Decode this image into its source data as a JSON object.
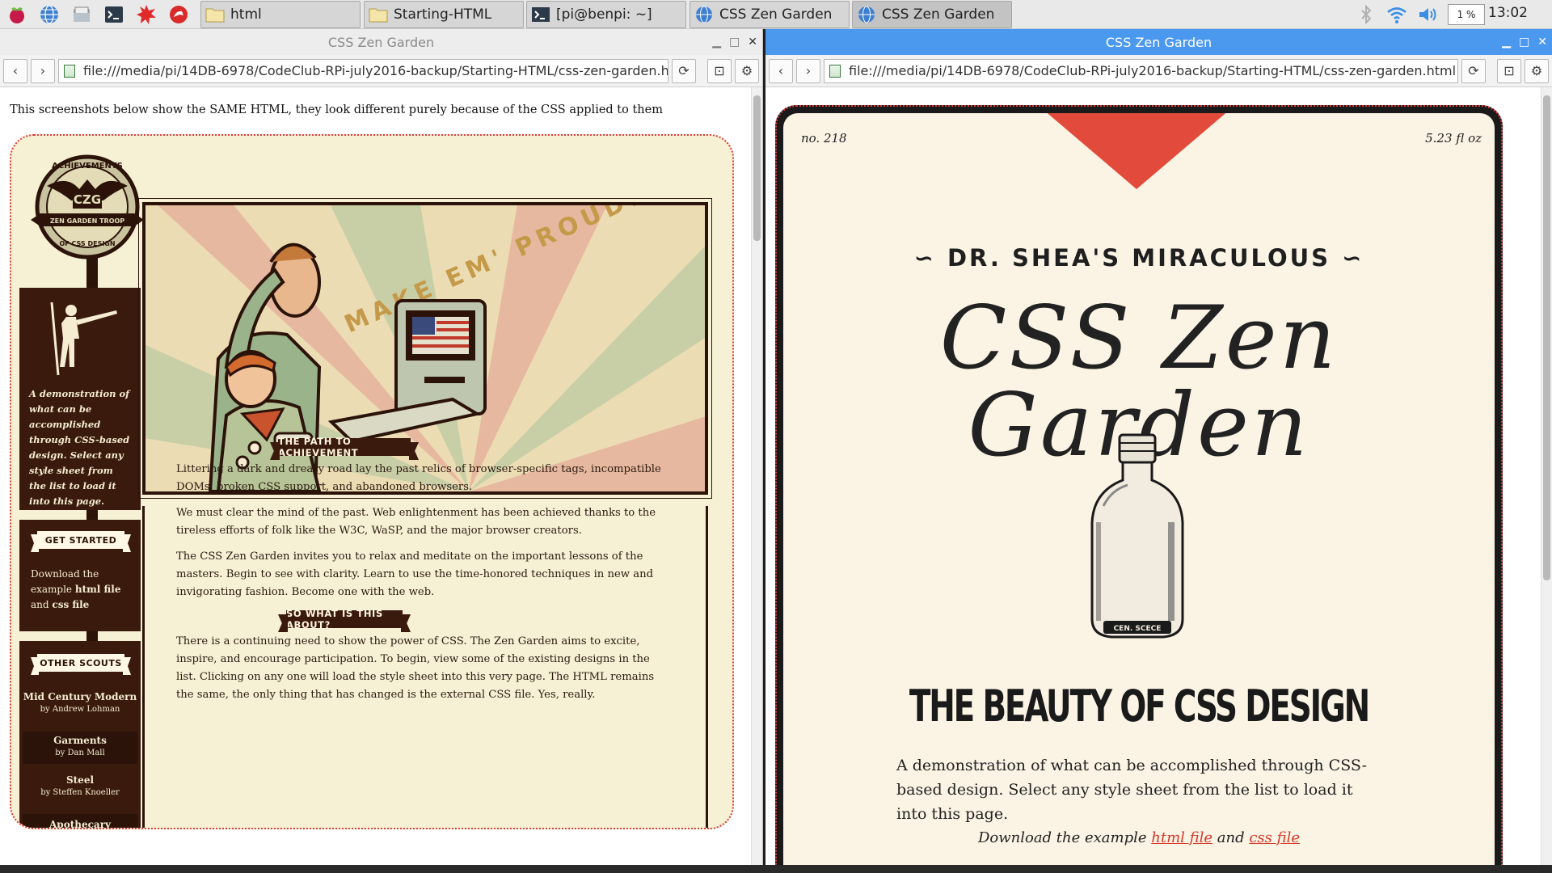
{
  "taskbar": {
    "tasks": [
      {
        "label": "html"
      },
      {
        "label": "Starting-HTML"
      },
      {
        "label": "[pi@benpi: ~]"
      },
      {
        "label": "CSS Zen Garden"
      },
      {
        "label": "CSS Zen Garden"
      }
    ],
    "cpu": "1 %",
    "clock": "13:02"
  },
  "left_window": {
    "title": "CSS Zen Garden",
    "url": "file:///media/pi/14DB-6978/CodeClub-RPi-july2016-backup/Starting-HTML/css-zen-garden.html",
    "intro": "This screenshots below show the SAME HTML, they look different purely because of the CSS applied to them",
    "badge": {
      "top": "ACHIEVEMENTS",
      "mid": "CZG",
      "band": "ZEN GARDEN TROOP",
      "bottom": "OF CSS DESIGN"
    },
    "hero_text": "MAKE EM' PROUD!",
    "sidebar_desc": "A demonstration of what can be accomplished through CSS-based design. Select any style sheet from the list to load it into this page.",
    "get_started": {
      "heading": "GET STARTED",
      "text_a": "Download the example ",
      "html_link": "html file",
      "text_b": "and ",
      "css_link": "css file"
    },
    "other_scouts": {
      "heading": "OTHER SCOUTS",
      "items": [
        {
          "name": "Mid Century Modern",
          "by": "by Andrew Lohman"
        },
        {
          "name": "Garments",
          "by": "by Dan Mall"
        },
        {
          "name": "Steel",
          "by": "by Steffen Knoeller"
        },
        {
          "name": "Apothecary",
          "by": ""
        }
      ]
    },
    "sections": [
      {
        "heading": "THE PATH TO ACHIEVEMENT",
        "paragraphs": [
          "Littering a dark and dreary road lay the past relics of browser-specific tags, incompatible DOMs, broken CSS support, and abandoned browsers.",
          "We must clear the mind of the past. Web enlightenment has been achieved thanks to the tireless efforts of folk like the W3C, WaSP, and the major browser creators.",
          "The CSS Zen Garden invites you to relax and meditate on the important lessons of the masters. Begin to see with clarity. Learn to use the time-honored techniques in new and invigorating fashion. Become one with the web."
        ]
      },
      {
        "heading": "SO WHAT IS THIS ABOUT?",
        "paragraphs": [
          "There is a continuing need to show the power of CSS. The Zen Garden aims to excite, inspire, and encourage participation. To begin, view some of the existing designs in the list. Clicking on any one will load the style sheet into this very page. The HTML remains the same, the only thing that has changed is the external CSS file. Yes, really."
        ]
      }
    ]
  },
  "right_window": {
    "title": "CSS Zen Garden",
    "url": "file:///media/pi/14DB-6978/CodeClub-RPi-july2016-backup/Starting-HTML/css-zen-garden.html",
    "label_no": "no. 218",
    "label_oz": "5.23 fl oz",
    "subtitle": "DR. SHEA'S MIRACULOUS",
    "title_text": "CSS Zen Garden",
    "bottle_label": "CEN. SCECE",
    "beauty": "THE BEAUTY OF CSS DESIGN",
    "desc": "A demonstration of what can be accomplished through CSS-based design. Select any style sheet from the list to load it into this page.",
    "download_a": "Download the example ",
    "html_link": "html file",
    "download_b": " and ",
    "css_link": "css file"
  },
  "colors": {
    "accent_red": "#e23b3b",
    "brown": "#3a1a0c",
    "cream": "#f6f1d4",
    "titlebar_active": "#4b98ef"
  }
}
